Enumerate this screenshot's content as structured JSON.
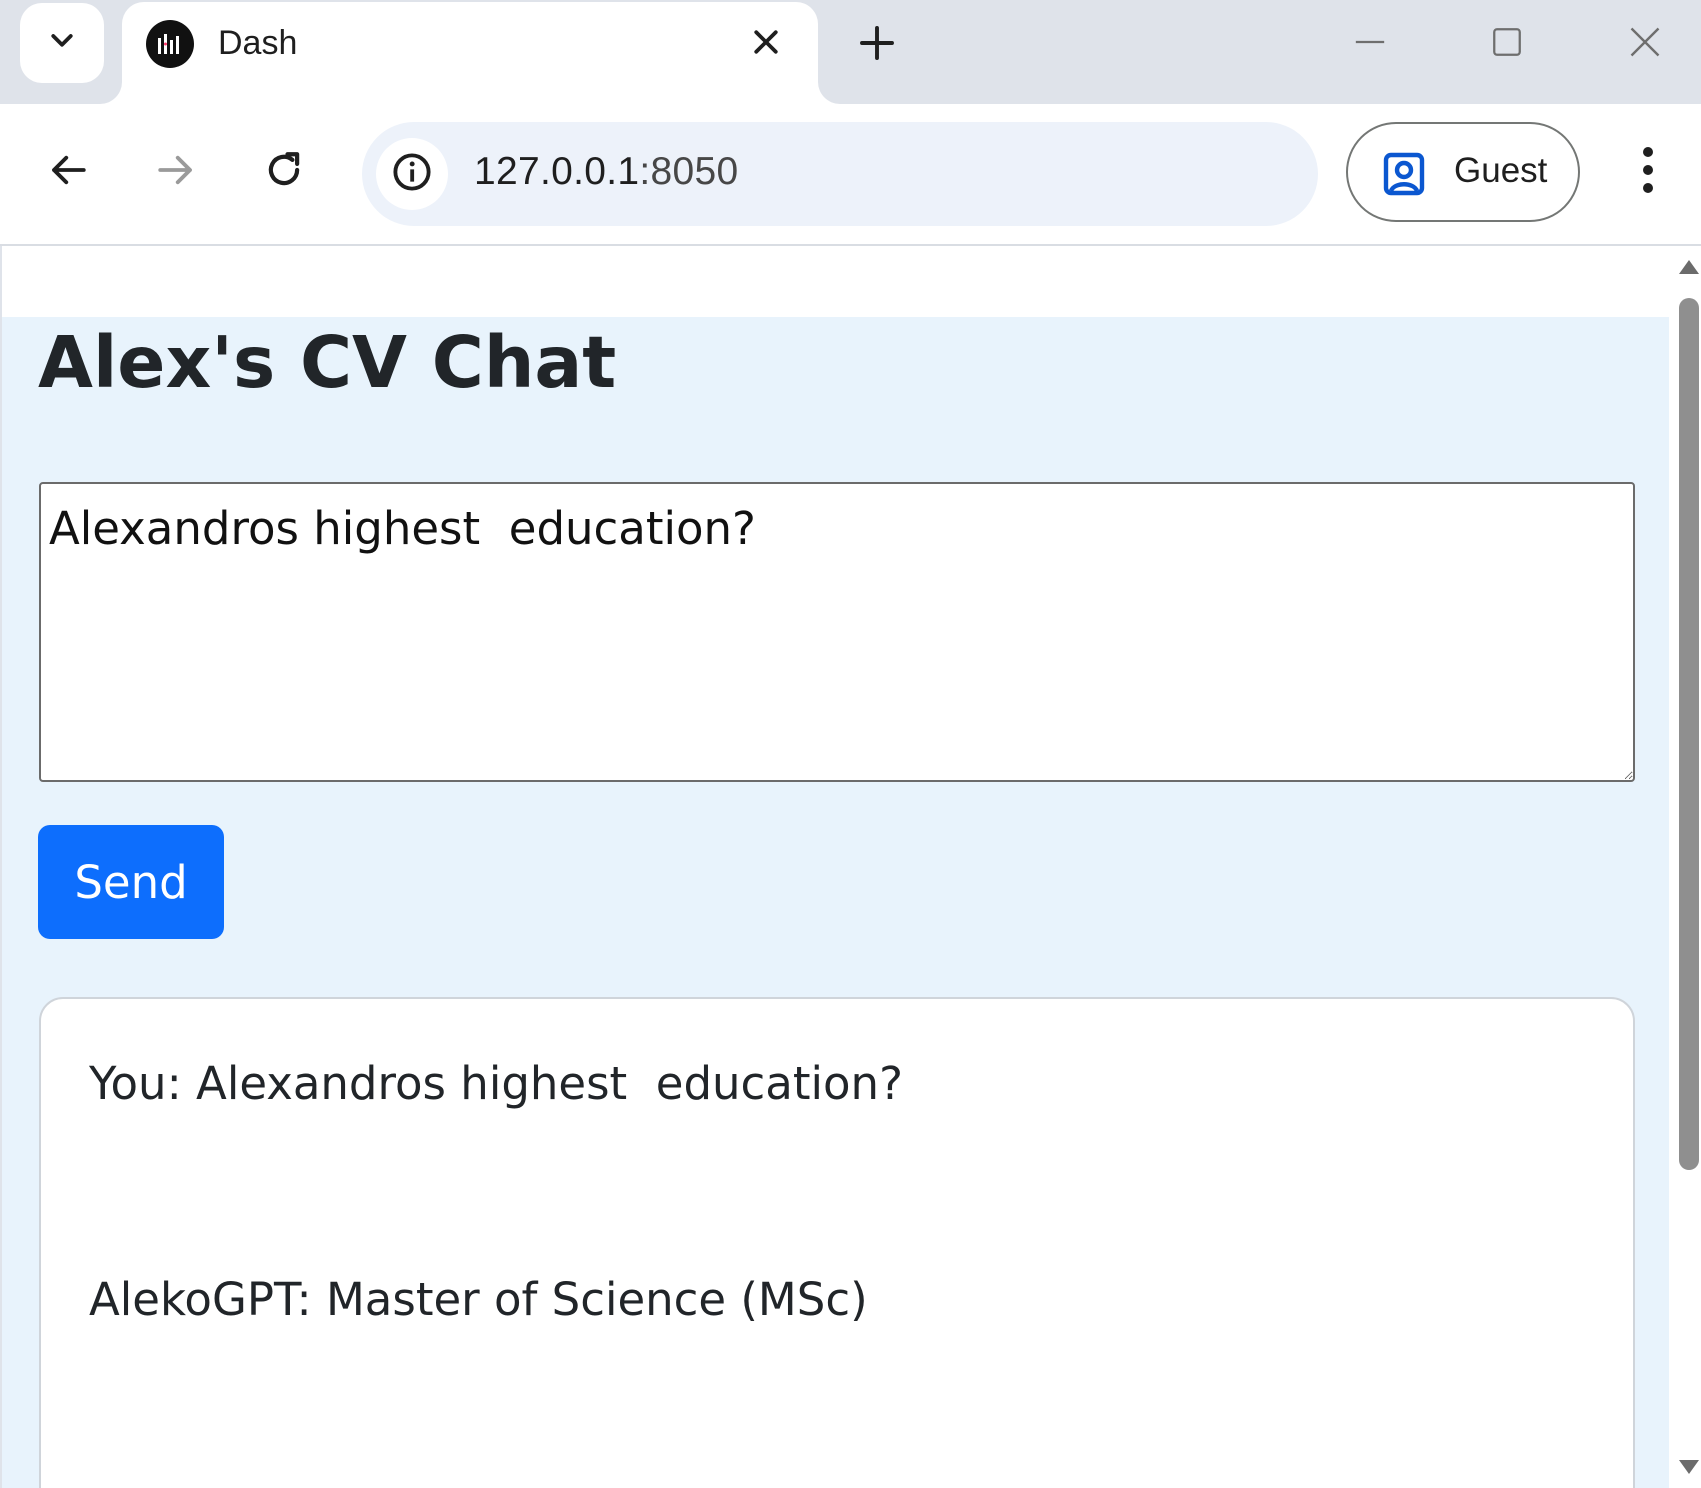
{
  "browser": {
    "tab": {
      "title": "Dash",
      "favicon": "dash-logo-icon"
    },
    "new_tab_icon": "plus-icon",
    "window_controls": [
      "minimize-icon",
      "maximize-icon",
      "close-icon"
    ],
    "address_bar": {
      "url_host": "127.0.0.1",
      "url_port": ":8050",
      "site_info_icon": "info-icon"
    },
    "profile": {
      "label": "Guest",
      "icon": "profile-icon",
      "accent_color": "#0b57d0"
    },
    "menu_icon": "kebab-menu-icon"
  },
  "page": {
    "title": "Alex's CV Chat",
    "background_color": "#e8f3fc",
    "input": {
      "value": "Alexandros highest  education?",
      "placeholder": ""
    },
    "send_button": {
      "label": "Send",
      "color": "#0d6efd"
    },
    "chat_log": {
      "messages": [
        {
          "text": "You: Alexandros highest  education?"
        },
        {
          "text": "AlekoGPT: Master of Science (MSc)"
        }
      ]
    }
  }
}
